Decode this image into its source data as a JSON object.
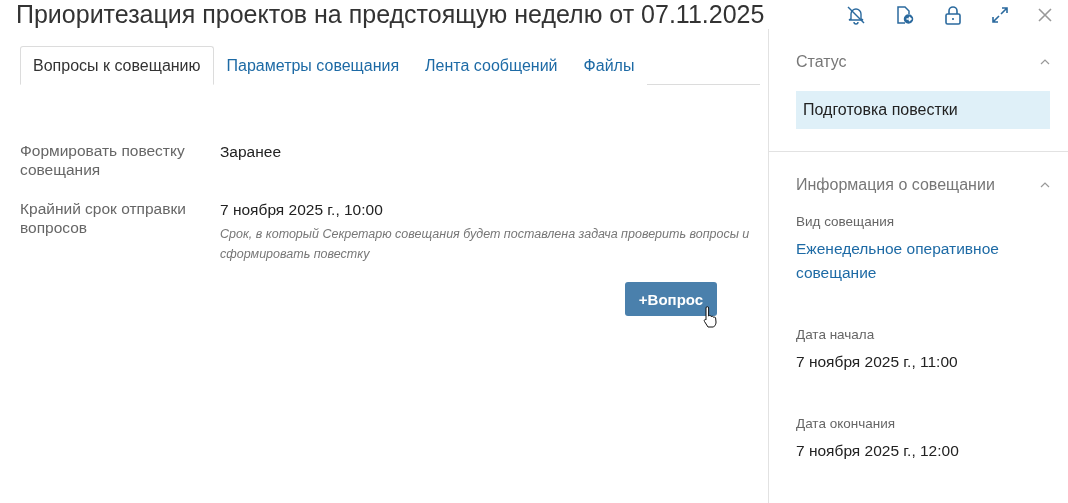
{
  "window": {
    "title": "Приоритезация проектов на предстоящую неделю от 07.11.2025"
  },
  "toolbar": [
    {
      "kind": "bell-off"
    },
    {
      "kind": "document-export"
    },
    {
      "kind": "lock"
    },
    {
      "kind": "expand"
    },
    {
      "kind": "close"
    }
  ],
  "tabs": [
    {
      "label": "Вопросы к совещанию",
      "selected": true
    },
    {
      "label": "Параметры совещания",
      "selected": false
    },
    {
      "label": "Лента сообщений",
      "selected": false
    },
    {
      "label": "Файлы",
      "selected": false
    }
  ],
  "fields": [
    {
      "label": "Формировать повестку совещания",
      "value": "Заранее"
    },
    {
      "label": "Крайний срок отправки вопросов",
      "value": "7 ноября 2025 г., 10:00",
      "hint": "Срок, в который Секретарю совещания будет поставлена задача проверить вопросы и сформировать повестку"
    }
  ],
  "add_button": {
    "label": "+Вопрос",
    "hovered": true
  },
  "status_section": {
    "title": "Статус",
    "expanded": true,
    "status": "Подготовка повестки"
  },
  "info_section": {
    "title": "Информация о совещании",
    "expanded": true,
    "items": [
      {
        "label": "Вид совещания",
        "value": "Еженедельное оперативное совещание",
        "kind": "link"
      },
      {
        "label": "Дата начала",
        "value": "7 ноября 2025 г., 11:00",
        "kind": "text"
      },
      {
        "label": "Дата окончания",
        "value": "7 ноября 2025 г., 12:00",
        "kind": "text"
      }
    ]
  }
}
